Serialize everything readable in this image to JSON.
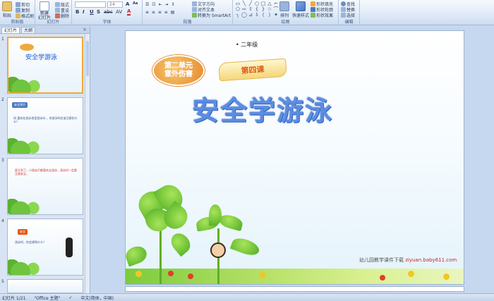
{
  "ribbon": {
    "clipboard": {
      "label": "剪贴板",
      "paste": "粘贴",
      "cut": "剪切",
      "copy": "复制",
      "format_painter": "格式刷"
    },
    "slides": {
      "label": "幻灯片",
      "new_slide": "新建\n幻灯片",
      "layout": "版式",
      "reset": "重设",
      "delete": "删除"
    },
    "font": {
      "label": "字体",
      "font_name": "",
      "font_size": "24"
    },
    "paragraph": {
      "label": "段落",
      "text_direction": "文字方向",
      "align_text": "对齐文本",
      "smartart": "转换为 SmartArt"
    },
    "drawing": {
      "label": "绘图",
      "arrange": "排列",
      "quick_styles": "快速样式",
      "shape_fill": "形状填充",
      "shape_outline": "形状轮廓",
      "shape_effects": "形状效果"
    },
    "editing": {
      "label": "编辑",
      "find": "查找",
      "replace": "替换",
      "select": "选择"
    },
    "format_buttons": [
      "B",
      "I",
      "U",
      "S",
      "abc",
      "AV",
      "Aa",
      "A"
    ],
    "shape_glyphs": [
      "▭",
      "╲",
      "╱",
      "○",
      "□",
      "△",
      "⌐",
      "⬠",
      "⇨",
      "⇧",
      "{",
      "}",
      "☆",
      "⌒",
      "╮",
      "◯",
      "⊿",
      "⇩",
      "⟨",
      "⟩",
      "✦"
    ]
  },
  "left_panel": {
    "tab_slides": "幻灯片",
    "tab_outline": "大纲",
    "close": "×",
    "thumbnails": [
      {
        "num": "1"
      },
      {
        "num": "2",
        "label": "安全常识",
        "text": "同 喜欢在游泳池里游泳吗 ，你游泳时应该注意些什么？"
      },
      {
        "num": "3",
        "text": "夏天到了，小朋友们都喜欢去游泳，游泳时一定要注意安全。"
      },
      {
        "num": "4",
        "label": "安全",
        "text": "游泳时，你会想到什么？"
      },
      {
        "num": "5"
      }
    ]
  },
  "slide": {
    "grade": "• 二年级",
    "unit_line1": "第二单元",
    "unit_line2": "意外伤害",
    "lesson": "第四课",
    "title": "安全学游泳",
    "footer_prefix": "幼儿园教学课件下载",
    "footer_url": "ziyuan.baby611.com"
  },
  "status": {
    "slide_count": "幻灯片 1/21",
    "theme": "\"Office 主题\"",
    "language": "中文(简体，中国)"
  }
}
